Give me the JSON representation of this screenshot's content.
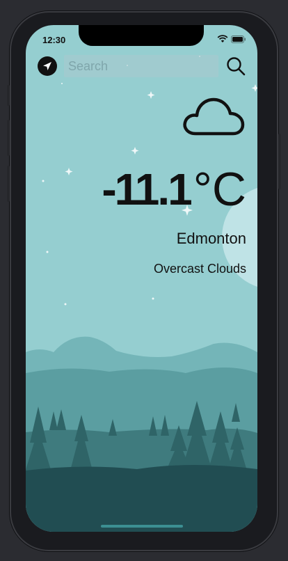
{
  "status": {
    "time": "12:30"
  },
  "search": {
    "placeholder": "Search"
  },
  "weather": {
    "temperature": "-11.1",
    "unit": "°C",
    "city": "Edmonton",
    "condition": "Overcast Clouds",
    "icon": "cloud-icon"
  },
  "colors": {
    "sky": "#95ced0",
    "mountains_far": "#74b5b8",
    "mountains_mid": "#5b9ea1",
    "trees": "#2f6467",
    "ground": "#214d52"
  }
}
